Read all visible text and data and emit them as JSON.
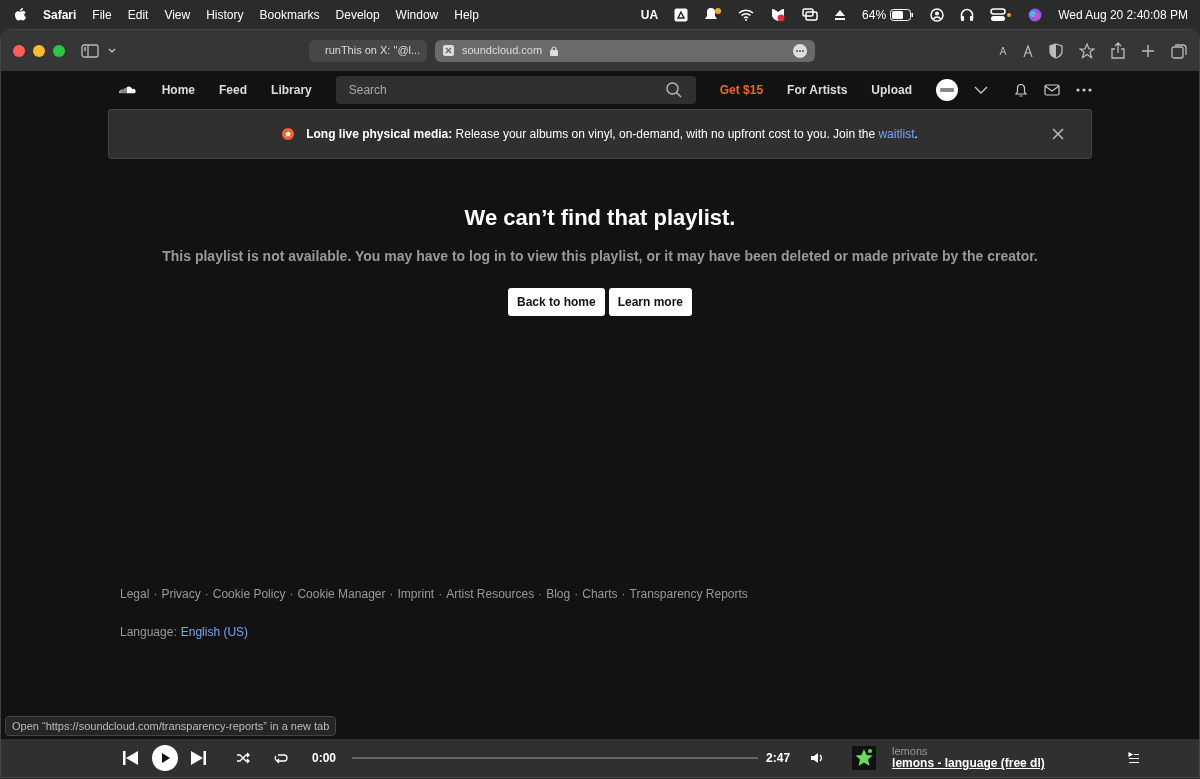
{
  "menu_bar": {
    "app": "Safari",
    "items": [
      "File",
      "Edit",
      "View",
      "History",
      "Bookmarks",
      "Develop",
      "Window",
      "Help"
    ],
    "input_source": "UA",
    "battery": "64%",
    "clock": "Wed Aug 20  2:40:08 PM"
  },
  "browser": {
    "tabs": [
      {
        "label": "runThis on X: \"@l...",
        "selected": false
      },
      {
        "label": "soundcloud.com",
        "selected": true
      }
    ]
  },
  "site_nav": {
    "links": [
      "Home",
      "Feed",
      "Library"
    ],
    "search": {
      "placeholder": "Search"
    },
    "promo": "Get $15",
    "right_links": [
      "For Artists",
      "Upload"
    ]
  },
  "banner": {
    "text": "**Long live physical media:** Release your albums on vinyl, on-demand, with no upfront cost to you. Join the ",
    "link": "waitlist",
    "end": "."
  },
  "error": {
    "title": "We can’t find that playlist.",
    "message": "This playlist is not available. You may have to log in to view this playlist, or it may have been deleted or made private by the creator.",
    "buttons": [
      "Back to home",
      "Learn more"
    ]
  },
  "footer": {
    "separator": "·",
    "links": [
      "Legal",
      "Privacy",
      "Cookie Policy",
      "Cookie Manager",
      "Imprint",
      "Artist Resources",
      "Blog",
      "Charts",
      "Transparency Reports"
    ],
    "language_label": "Language:",
    "language": "English (US)"
  },
  "status_bar": "Open “https://soundcloud.com/transparency-reports” in a new tab",
  "player": {
    "elapsed": "0:00",
    "duration": "2:47",
    "level": 0,
    "artist": "lemons",
    "title": "lemons - language (free dl)"
  }
}
